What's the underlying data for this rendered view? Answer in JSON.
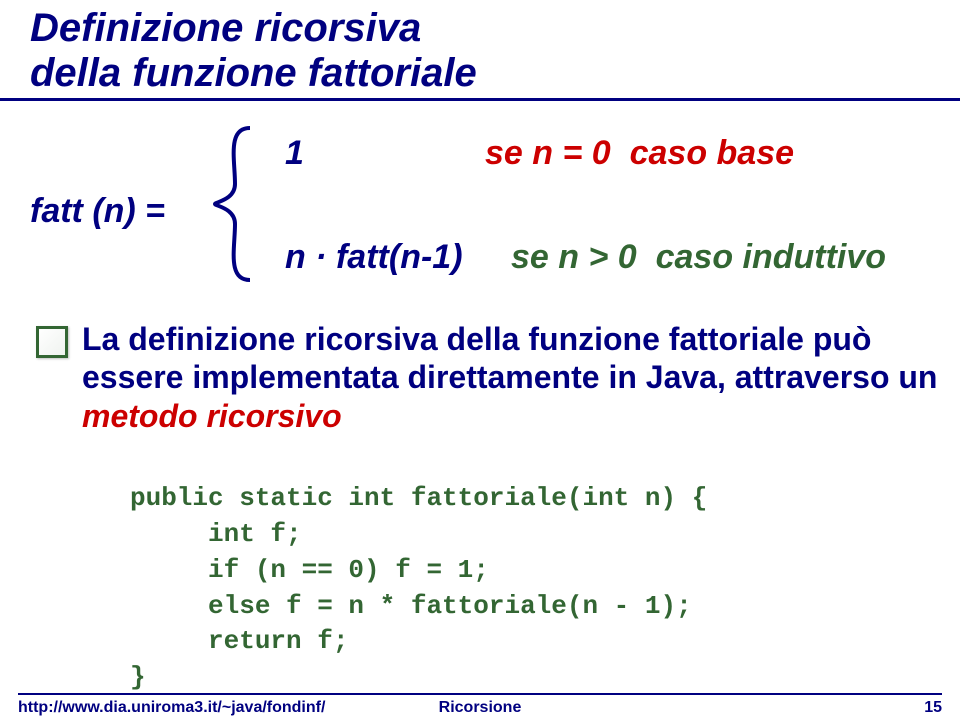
{
  "title": {
    "line1": "Definizione ricorsiva",
    "line2": "della funzione fattoriale"
  },
  "definition": {
    "lhs": "fatt (n) =",
    "base": {
      "lhs": "1",
      "rhs_prefix": "se ",
      "rhs_var": "n",
      "rhs_rest": " = 0  caso base"
    },
    "inductive": {
      "lhs_prefix": "n · fatt",
      "lhs_paren": "(",
      "lhs_var": "n",
      "lhs_rest": "-1)",
      "rhs_prefix": "se ",
      "rhs_var": "n",
      "rhs_rest": " > 0  caso induttivo"
    }
  },
  "bullet": {
    "text_before": "La definizione ricorsiva della funzione fattoriale può essere implementata direttamente in Java, attraverso un ",
    "accent": "metodo ricorsivo",
    "text_after": ""
  },
  "code": {
    "l1": "public static int fattoriale(int n) {",
    "l2": "     int f;",
    "l3": "     if (n == 0) f = 1;",
    "l4": "     else f = n * fattoriale(n - 1);",
    "l5": "     return f;",
    "l6": "}"
  },
  "footer": {
    "left": "http://www.dia.uniroma3.it/~java/fondinf/",
    "center": "Ricorsione",
    "right": "15"
  }
}
